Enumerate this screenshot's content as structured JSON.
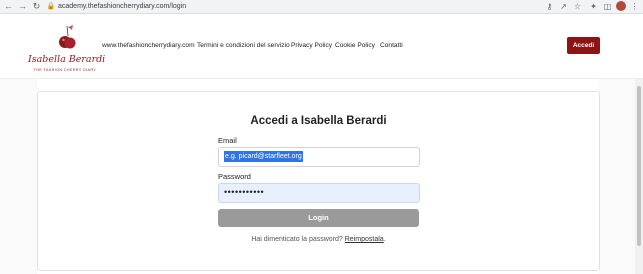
{
  "browser": {
    "url": "academy.thefashioncherrydiary.com/login",
    "icons": [
      "back-icon",
      "forward-icon",
      "reload-icon",
      "lock-icon",
      "key-icon",
      "share-icon",
      "star-icon",
      "extensions-icon",
      "sidepanel-icon",
      "avatar",
      "more-icon"
    ]
  },
  "header": {
    "logo_name": "Isabella Berardi",
    "logo_tagline": "THE FASHION CHERRY DIARY",
    "nav": [
      {
        "label": "www.thefashioncherrydiary.com"
      },
      {
        "label": "Termini e condizioni del servizio"
      },
      {
        "label": "Privacy Policy"
      },
      {
        "label": "Cookie Policy"
      },
      {
        "label": "Contatti"
      }
    ],
    "signin_label": "Accedi",
    "brand_color": "#8c1414"
  },
  "login": {
    "title": "Accedi a Isabella Berardi",
    "email_label": "Email",
    "email_placeholder": "e.g. picard@starfleet.org",
    "password_label": "Password",
    "password_mask": "•••••••••••",
    "submit_label": "Login",
    "forgot_text": "Hai dimenticato la password?",
    "reset_link": "Reimpostala",
    "reset_suffix": "."
  }
}
